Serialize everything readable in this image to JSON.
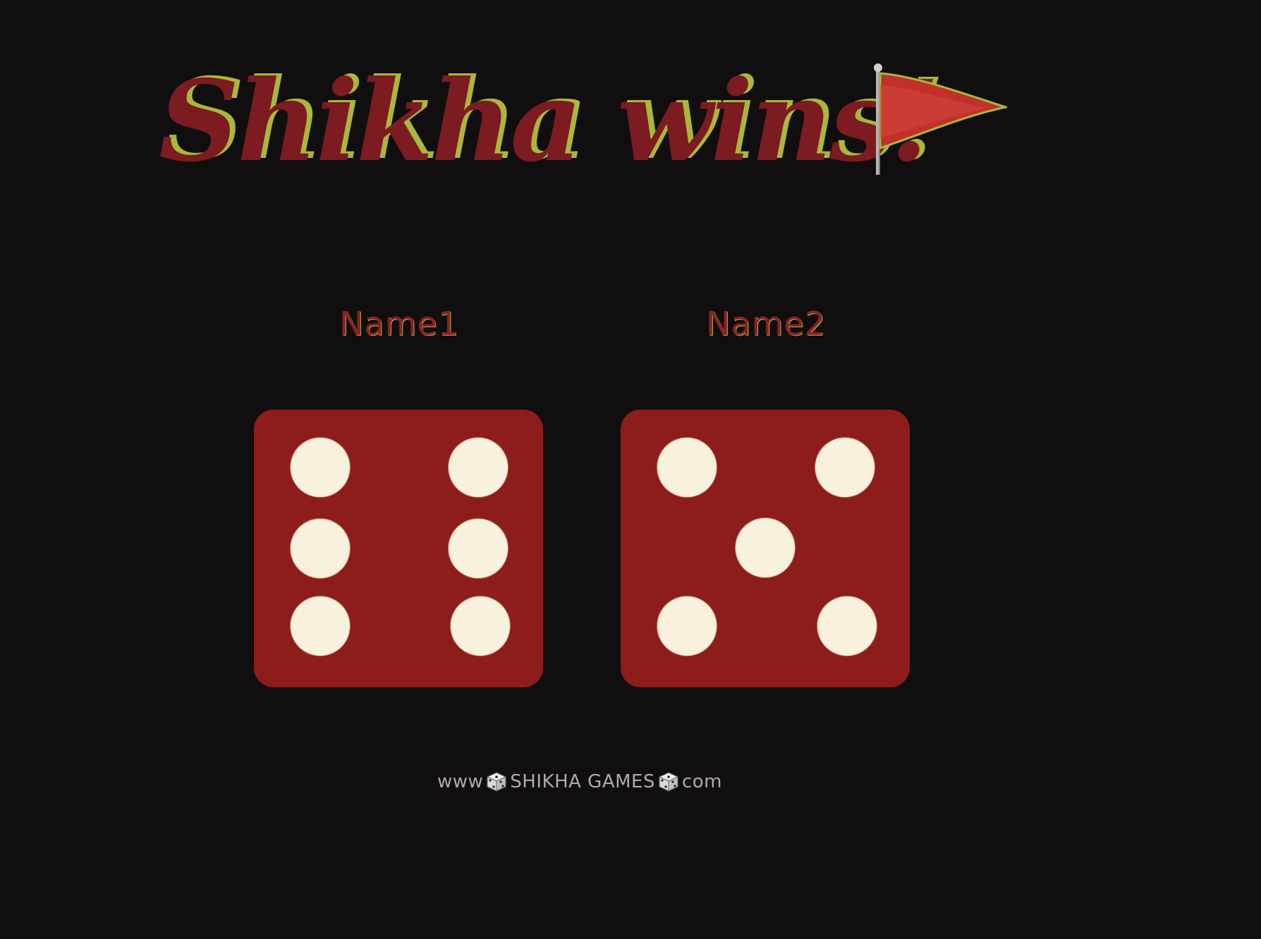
{
  "title": {
    "text": "Shikha wins!",
    "icon": "red-flag-icon"
  },
  "players": [
    {
      "name": "Name1",
      "die_value": 6
    },
    {
      "name": "Name2",
      "die_value": 5
    }
  ],
  "footer": {
    "prefix": "www",
    "brand": "SHIKHA GAMES",
    "suffix": "com",
    "icon": "dice-icon"
  },
  "colors": {
    "background": "#110e0f",
    "title": "#7c1b20",
    "title_outline": "#a8b83a",
    "die_face": "#8c1d1b",
    "pip": "#f7f1dd",
    "footer_text": "#b1a9a9"
  }
}
